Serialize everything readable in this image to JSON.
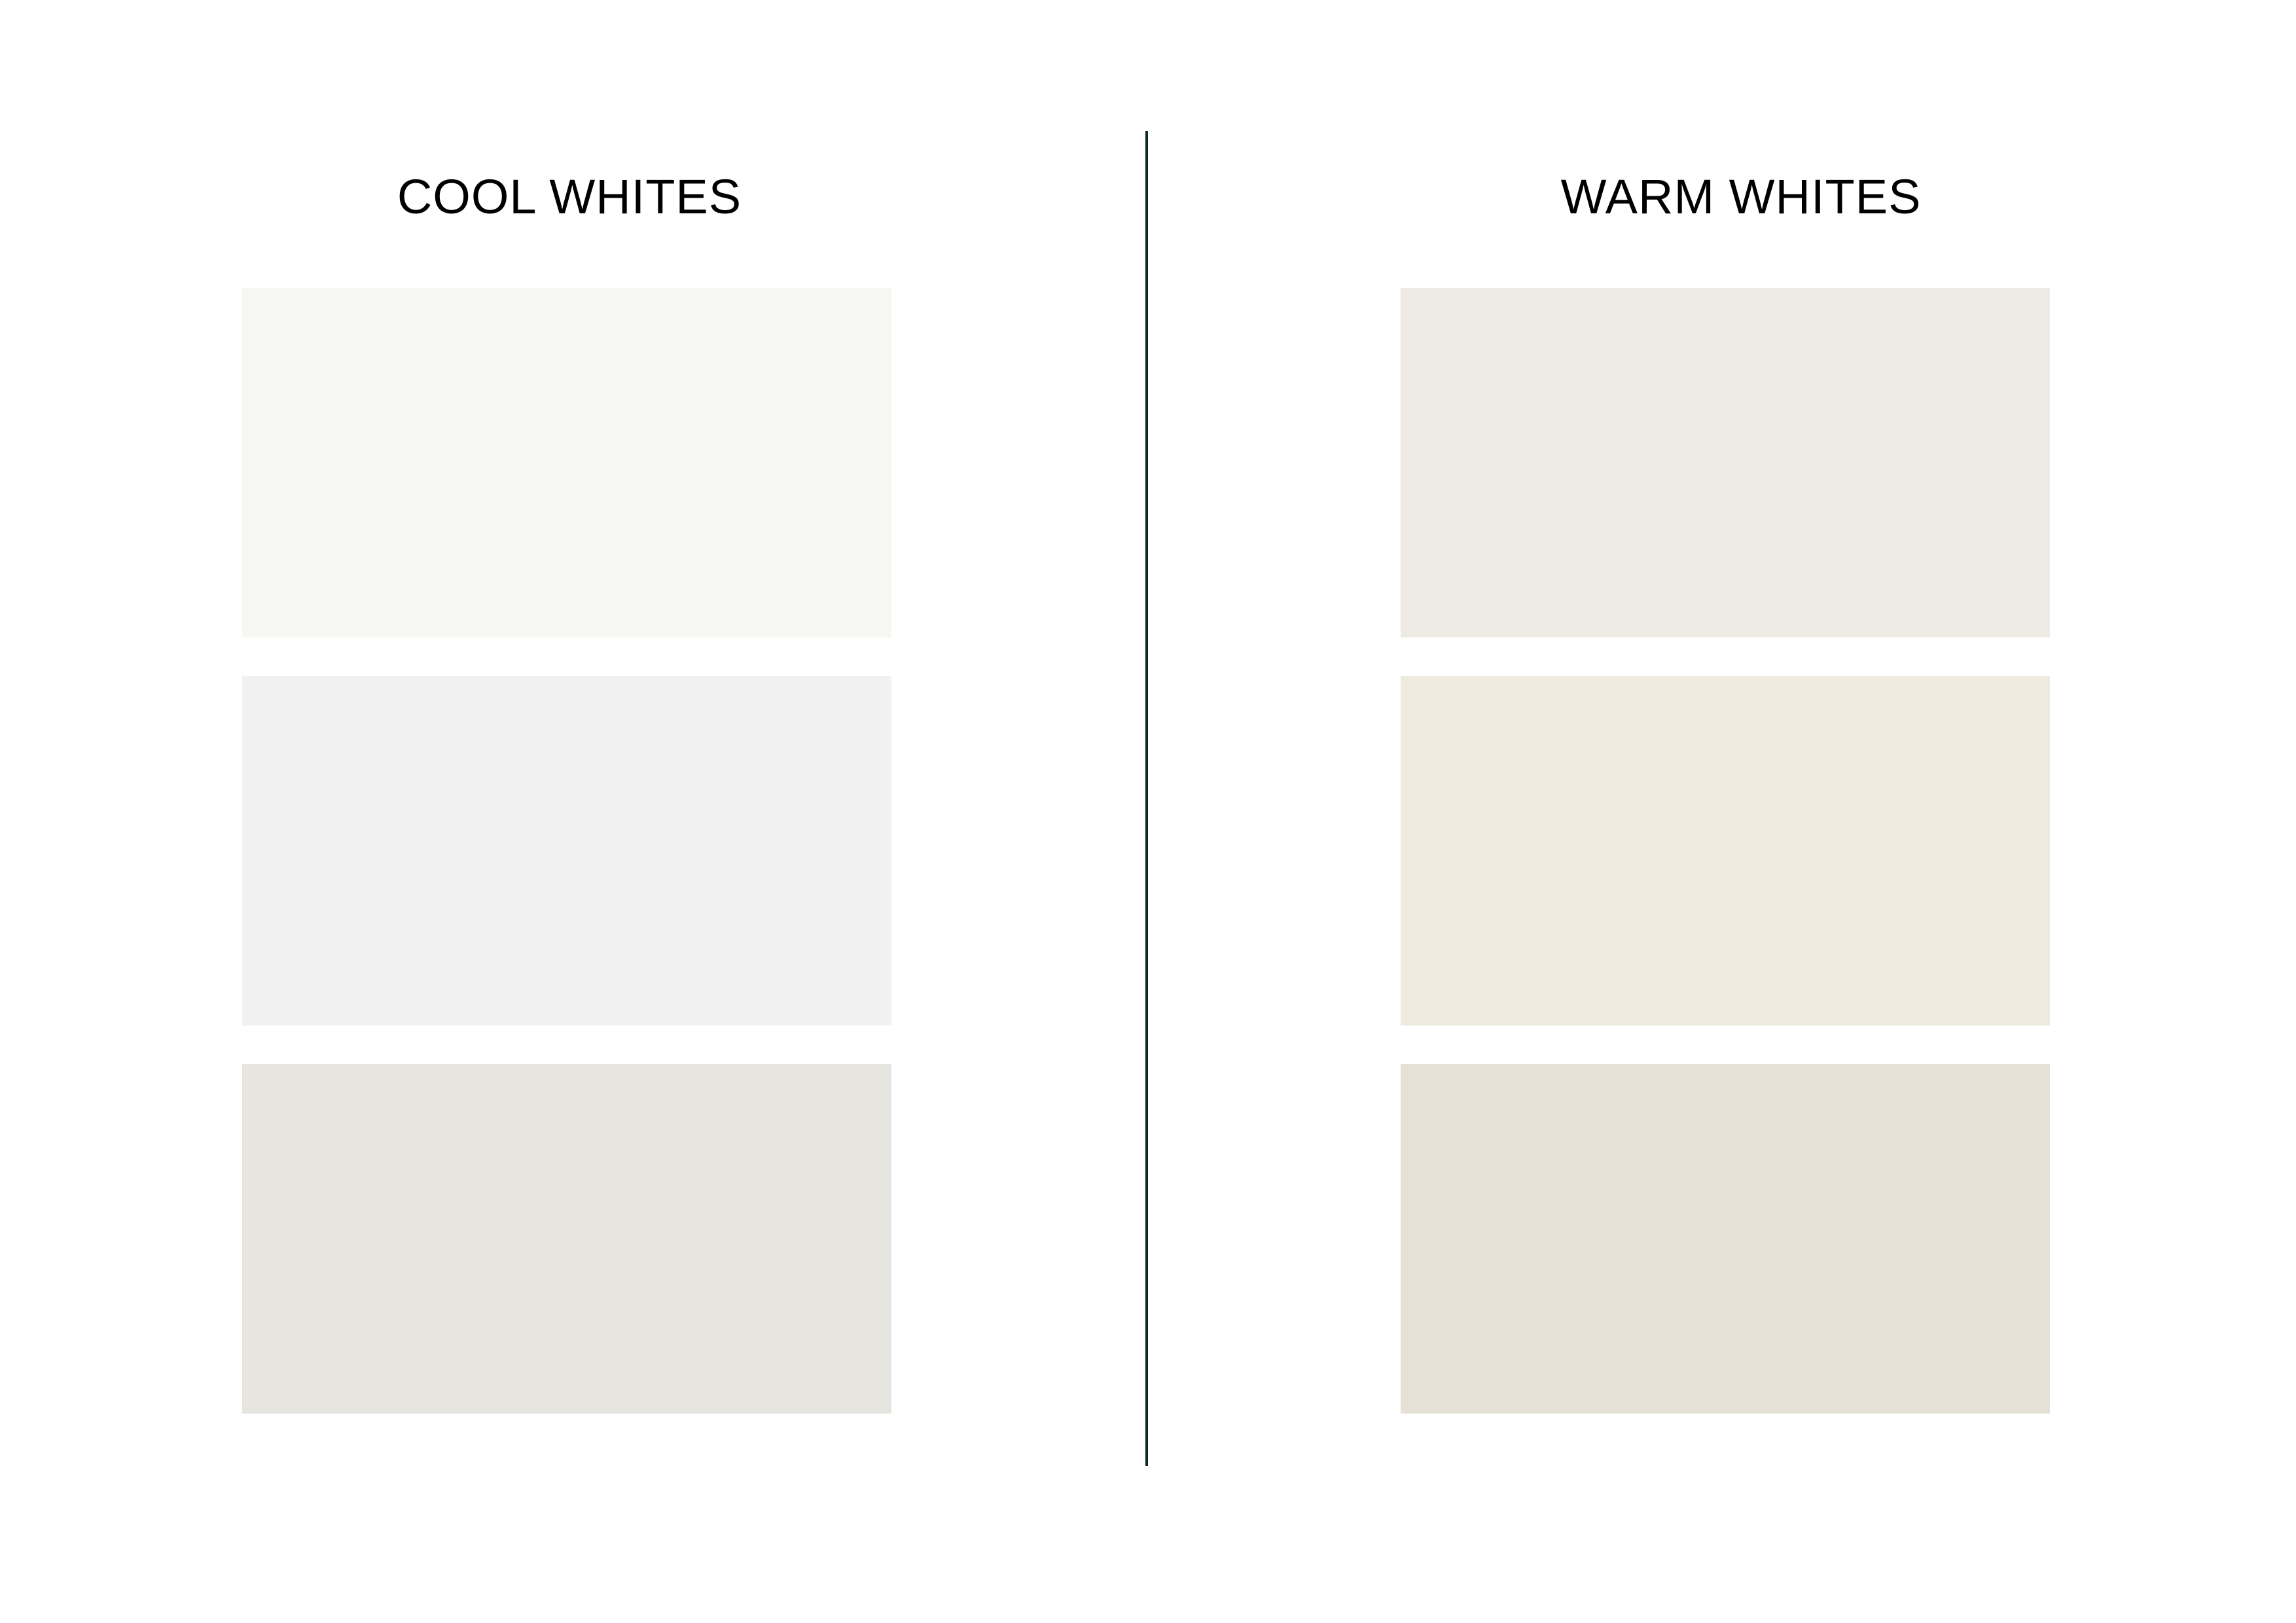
{
  "cool_whites": {
    "title": "COOL WHITES",
    "swatches": [
      {
        "color": "#f6f6f2"
      },
      {
        "color": "#f1f1f1"
      },
      {
        "color": "#e6e5e0"
      }
    ]
  },
  "warm_whites": {
    "title": "WARM WHITES",
    "swatches": [
      {
        "color": "#eeebe4"
      },
      {
        "color": "#eeeae0"
      },
      {
        "color": "#e5e1d6"
      }
    ]
  },
  "divider_color": "#0f2a1f"
}
